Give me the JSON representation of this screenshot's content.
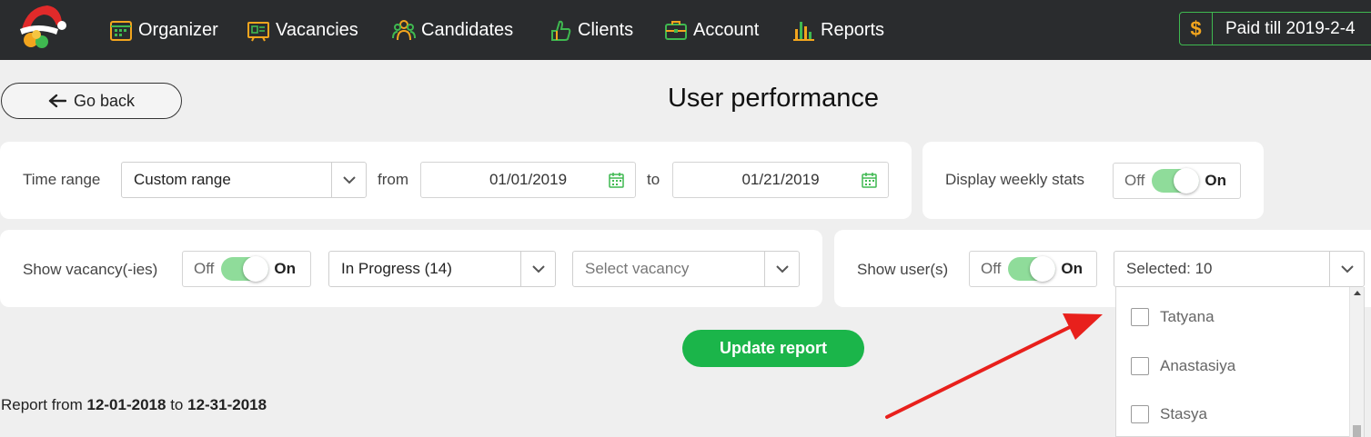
{
  "nav": {
    "items": [
      {
        "label": "Organizer",
        "icon": "calendar-icon"
      },
      {
        "label": "Vacancies",
        "icon": "vacancy-board-icon"
      },
      {
        "label": "Candidates",
        "icon": "people-icon"
      },
      {
        "label": "Clients",
        "icon": "hand-thumb-icon"
      },
      {
        "label": "Account",
        "icon": "briefcase-icon"
      },
      {
        "label": "Reports",
        "icon": "bar-chart-icon"
      }
    ],
    "paid_symbol": "$",
    "paid_text": "Paid till 2019-2-4"
  },
  "header": {
    "go_back": "Go back",
    "title": "User performance"
  },
  "time_range": {
    "label": "Time range",
    "selected": "Custom range",
    "from_label": "from",
    "from_value": "01/01/2019",
    "to_label": "to",
    "to_value": "01/21/2019"
  },
  "weekly": {
    "label": "Display weekly stats",
    "off": "Off",
    "on": "On"
  },
  "vacancies": {
    "label": "Show vacancy(-ies)",
    "off": "Off",
    "on": "On",
    "status_selected": "In Progress (14)",
    "vacancy_placeholder": "Select vacancy"
  },
  "users": {
    "label": "Show user(s)",
    "off": "Off",
    "on": "On",
    "selected": "Selected: 10",
    "list": [
      "Tatyana",
      "Anastasiya",
      "Stasya"
    ]
  },
  "actions": {
    "update": "Update report"
  },
  "report": {
    "prefix": "Report from",
    "from": "12-01-2018",
    "mid": "to",
    "to": "12-31-2018"
  },
  "colors": {
    "accent_green": "#1bb54a",
    "toggle_green": "#8fdc9a",
    "topbar": "#2a2c2e",
    "annotation_arrow": "#e8201c"
  }
}
